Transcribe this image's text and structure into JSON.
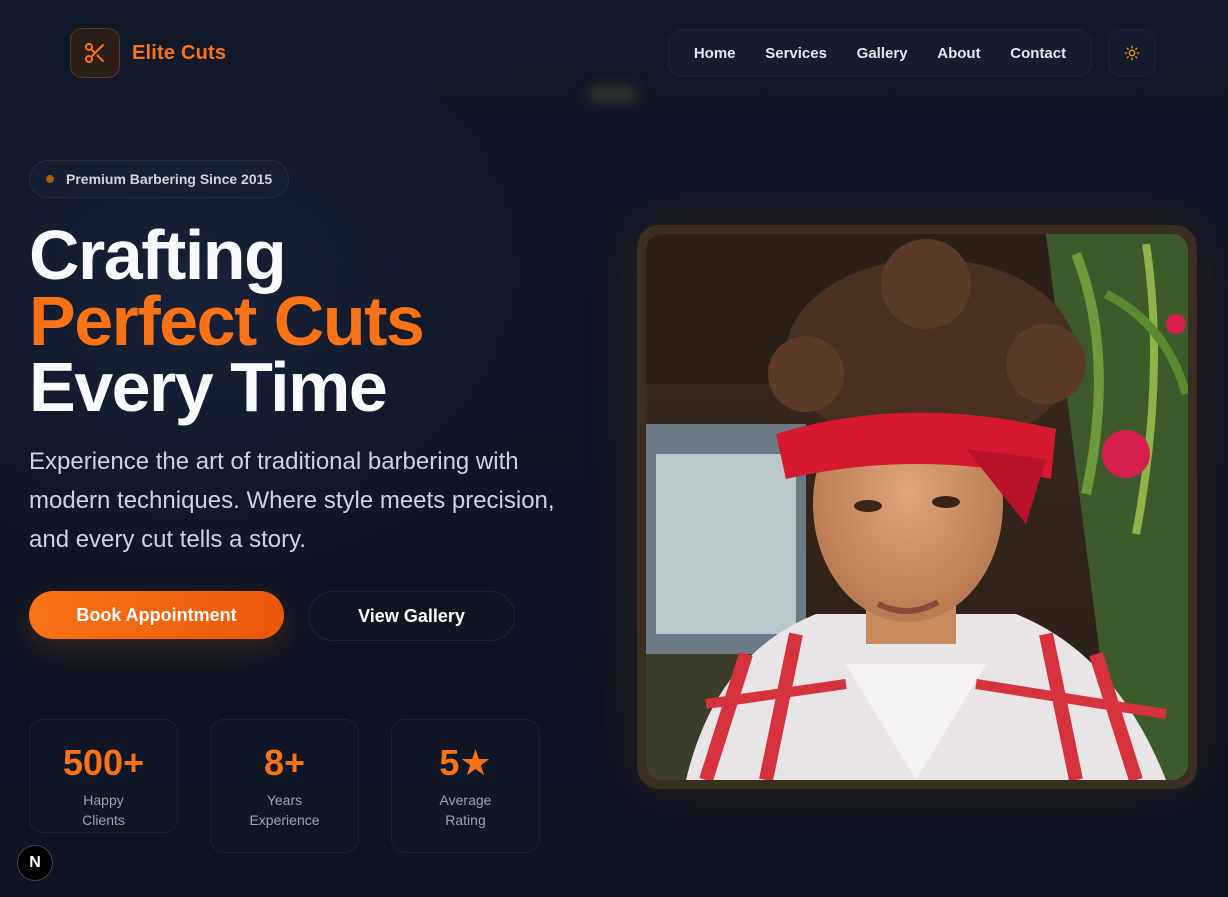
{
  "brand": {
    "name": "Elite Cuts",
    "icon": "scissors-icon"
  },
  "nav": {
    "items": [
      {
        "label": "Home"
      },
      {
        "label": "Services"
      },
      {
        "label": "Gallery"
      },
      {
        "label": "About"
      },
      {
        "label": "Contact"
      }
    ],
    "theme_toggle_icon": "sun-icon"
  },
  "hero": {
    "badge": "Premium Barbering Since 2015",
    "title_line1": "Crafting",
    "title_line2": "Perfect Cuts",
    "title_line3": "Every Time",
    "description": "Experience the art of traditional barbering with modern techniques. Where style meets precision, and every cut tells a story.",
    "primary_cta": "Book Appointment",
    "secondary_cta": "View Gallery",
    "image_subject": "portrait of young man with curly hair, red bandana headband and red plaid shirt"
  },
  "stats": [
    {
      "value": "500+",
      "label": "Happy Clients"
    },
    {
      "value": "8+",
      "label": "Years Experience"
    },
    {
      "value": "5★",
      "label": "Average Rating"
    }
  ],
  "dev_badge": "N",
  "colors": {
    "accent": "#f97316",
    "accent_dark": "#ea580c",
    "background": "#0f1524",
    "text_primary": "#f8fafc",
    "text_muted": "#9ca3af"
  }
}
